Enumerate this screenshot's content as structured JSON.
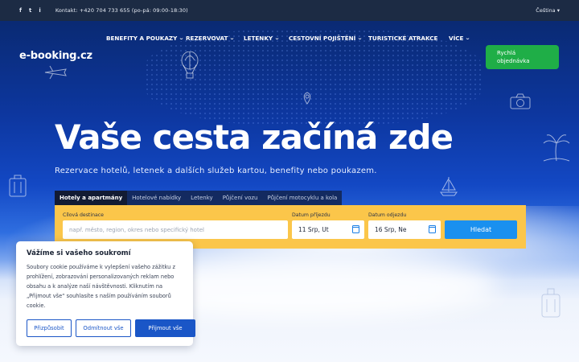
{
  "topbar": {
    "social": [
      "f",
      "t",
      "i"
    ],
    "contact": "Kontakt: +420 704 733 655 (po-pá: 09:00-18:30)",
    "language": "Čeština ▾"
  },
  "header": {
    "logo": "e-booking.cz",
    "nav": [
      {
        "label": "BENEFITY A POUKAZY",
        "caret": true
      },
      {
        "label": "REZERVOVAT",
        "caret": true
      },
      {
        "label": "LETENKY",
        "caret": true
      },
      {
        "label": "CESTOVNÍ POJIŠTĚNÍ",
        "caret": true
      },
      {
        "label": "TURISTICKÉ ATRAKCE",
        "caret": false
      },
      {
        "label": "VÍCE",
        "caret": true
      }
    ],
    "cta_line1": "Rychlá",
    "cta_line2": "objednávka"
  },
  "hero": {
    "title": "Vaše cesta začíná zde",
    "subtitle": "Rezervace hotelů, letenek a dalších služeb kartou, benefity nebo poukazem."
  },
  "tabs": [
    "Hotely a apartmány",
    "Hotelové nabídky",
    "Letenky",
    "Půjčení vozu",
    "Půjčení motocyklu a kola"
  ],
  "search": {
    "destination_label": "Cílová destinace",
    "destination_placeholder": "např. město, region, okres nebo specifický hotel",
    "checkin_label": "Datum příjezdu",
    "checkin_value": "11 Srp, Ut",
    "checkout_label": "Datum odjezdu",
    "checkout_value": "16 Srp, Ne",
    "button": "Hledat"
  },
  "cookie": {
    "title": "Vážíme si vašeho soukromí",
    "body": "Soubory cookie používáme k vylepšení vašeho zážitku z prohlížení, zobrazování personalizovaných reklam nebo obsahu a k analýze naší návštěvnosti. Kliknutím na „Přijmout vše“ souhlasíte s naším používáním souborů cookie.",
    "customize": "Přizpůsobit",
    "reject": "Odmítnout vše",
    "accept": "Přijmout vše"
  },
  "colors": {
    "topbar": "#1c2b44",
    "cta": "#1fae47",
    "search_bar": "#fbc64a",
    "search_button": "#1a90ef",
    "cookie_accent": "#1a56c7"
  }
}
